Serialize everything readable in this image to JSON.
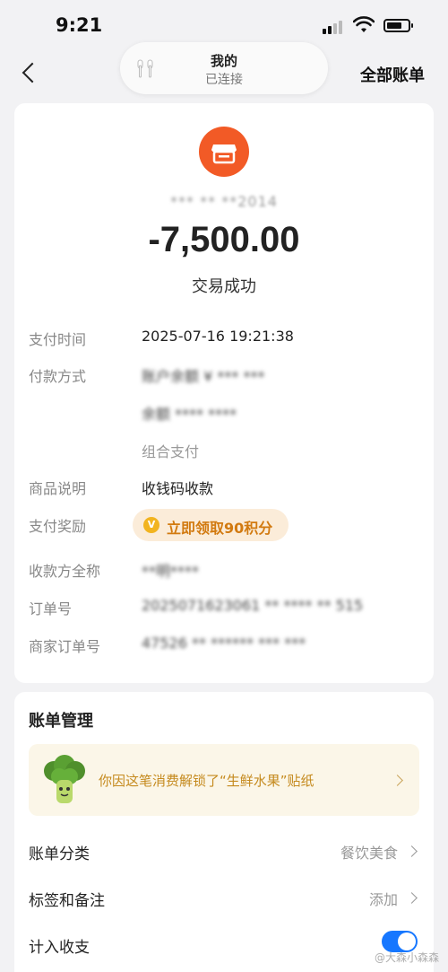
{
  "status_bar": {
    "time": "9:21"
  },
  "nav": {
    "title": "我的",
    "subtitle": "已连接",
    "right_action": "全部账单"
  },
  "transaction": {
    "payee_masked": "*** ** **2014",
    "amount": "-7,500.00",
    "status": "交易成功",
    "details": [
      {
        "label": "支付时间",
        "value": "2025-07-16 19:21:38"
      },
      {
        "label": "付款方式",
        "value": "账户余额 ¥ *** ***",
        "value2": "余额 **** ****",
        "value3": "组合支付"
      },
      {
        "label": "商品说明",
        "value": "收钱码收款"
      },
      {
        "label": "支付奖励",
        "reward": "立即领取90积分",
        "reward_icon": "V"
      },
      {
        "label": "收款方全称",
        "value": "**明****"
      },
      {
        "label": "订单号",
        "value": "2025071623061 ** **** ** 515"
      },
      {
        "label": "商家订单号",
        "value": "47526 ** ****** *** ***"
      }
    ]
  },
  "manage": {
    "title": "账单管理",
    "sticker_text": "你因这笔消费解锁了“生鲜水果”贴纸",
    "rows": [
      {
        "label": "账单分类",
        "value": "餐饮美食"
      },
      {
        "label": "标签和备注",
        "value": "添加"
      },
      {
        "label": "计入收支",
        "toggle": true
      }
    ]
  },
  "watermark": "@大森小森森",
  "colors": {
    "accent": "#f25a26",
    "toggle": "#1677ff",
    "reward": "#d27a10"
  }
}
